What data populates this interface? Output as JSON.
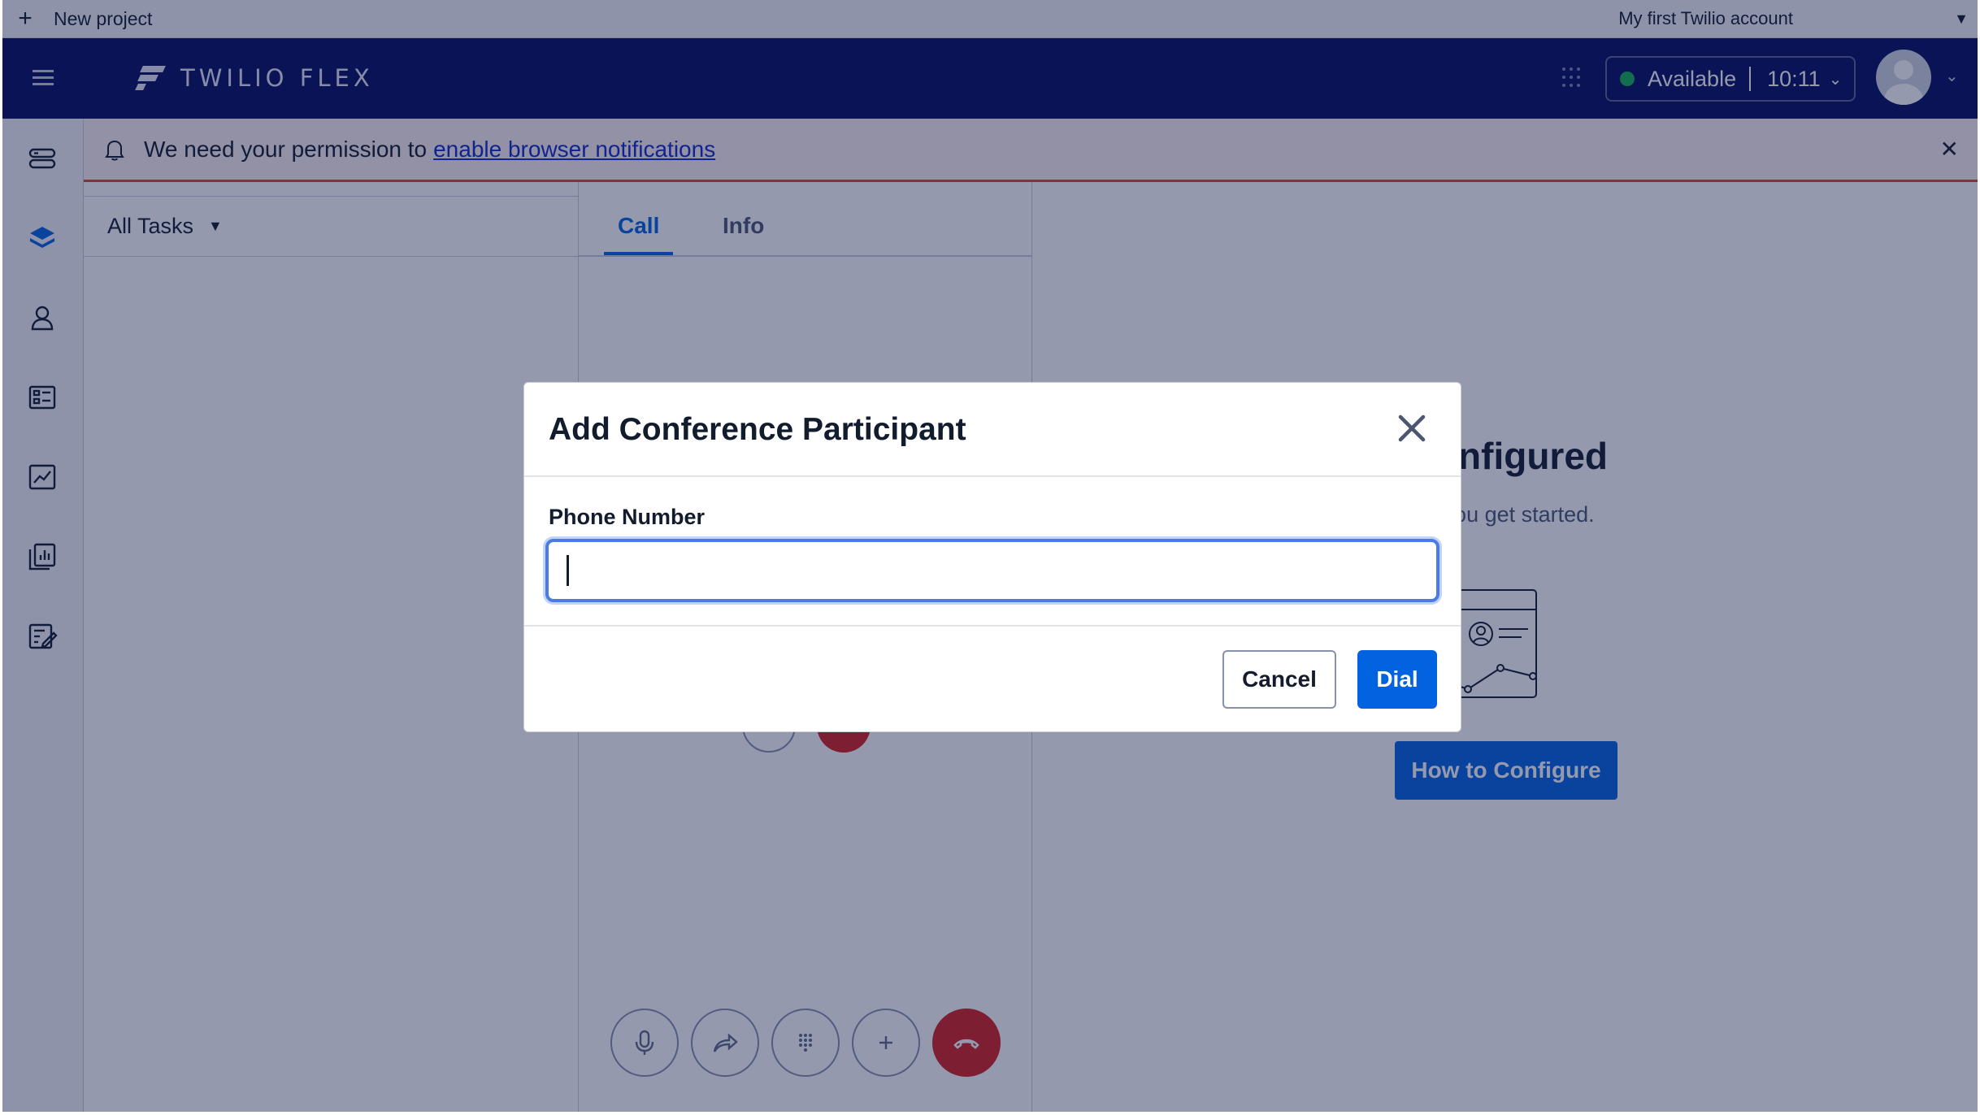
{
  "topbar": {
    "new_project": "New project",
    "account": "My first Twilio account"
  },
  "header": {
    "brand": "TWILIO FLEX",
    "status_label": "Available",
    "status_time": "10:11"
  },
  "banner": {
    "message": "We need your permission to",
    "link": "enable browser notifications"
  },
  "task_list": {
    "filter_label": "All Tasks"
  },
  "call_panel": {
    "tabs": [
      {
        "label": "Call",
        "active": true
      },
      {
        "label": "Info",
        "active": false
      }
    ],
    "controls": [
      "microphone-icon",
      "transfer-icon",
      "dialpad-icon",
      "add-participant-icon",
      "hangup-icon"
    ]
  },
  "crm": {
    "title_partial": "/I configured",
    "subtitle_partial": "ı help you get started.",
    "button": "How to Configure"
  },
  "modal": {
    "title": "Add Conference Participant",
    "field_label": "Phone Number",
    "phone_value": "",
    "cancel_label": "Cancel",
    "dial_label": "Dial"
  },
  "colors": {
    "header_bg": "#030b5d",
    "accent": "#0263e0",
    "available": "#14b053",
    "hangup": "#d61f1f",
    "banner_border": "#d64b27"
  }
}
